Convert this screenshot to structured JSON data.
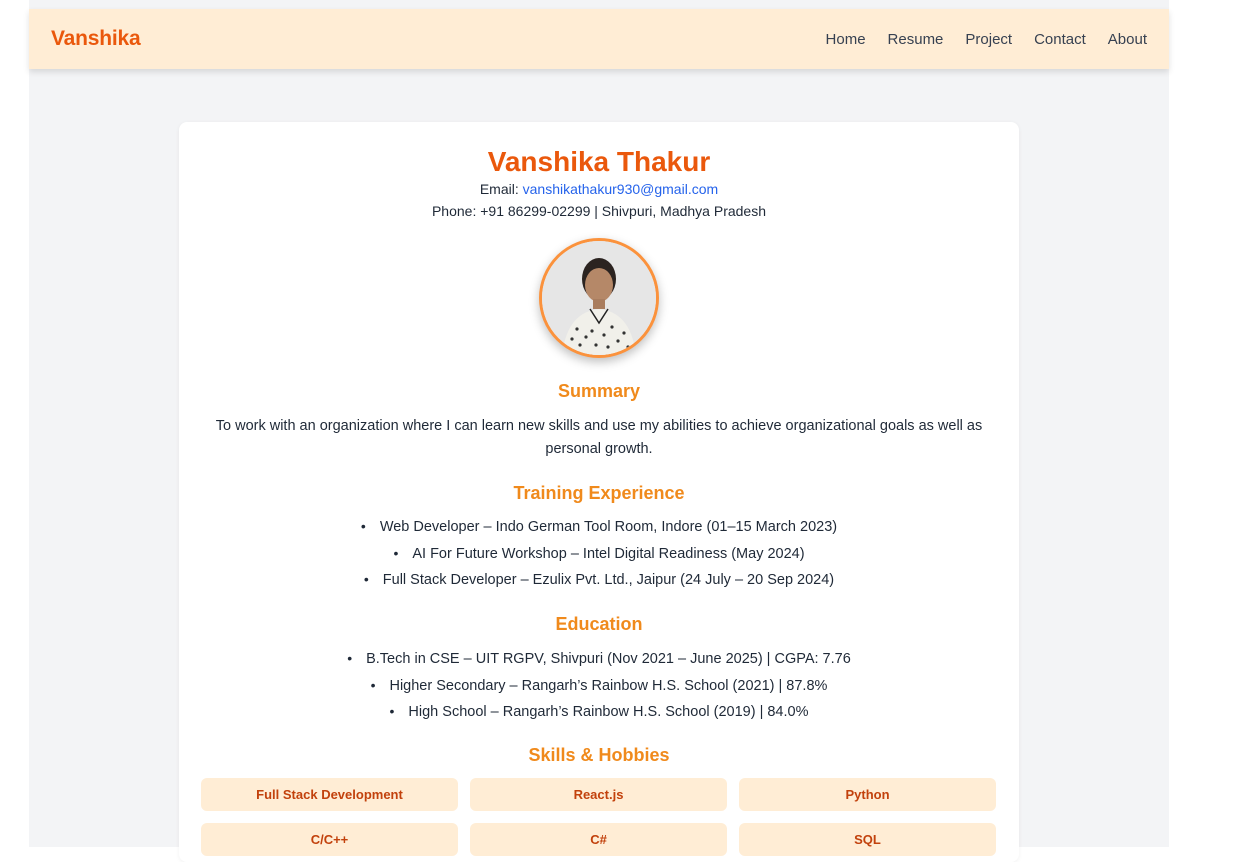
{
  "nav": {
    "brand": "Vanshika",
    "links": [
      "Home",
      "Resume",
      "Project",
      "Contact",
      "About"
    ]
  },
  "profile": {
    "name": "Vanshika Thakur",
    "email_label": "Email: ",
    "email": "vanshikathakur930@gmail.com",
    "phone_line": "Phone: +91 86299-02299 | Shivpuri, Madhya Pradesh"
  },
  "summary": {
    "title": "Summary",
    "text": "To work with an organization where I can learn new skills and use my abilities to achieve organizational goals as well as personal growth."
  },
  "training": {
    "title": "Training Experience",
    "items": [
      "Web Developer – Indo German Tool Room, Indore (01–15 March 2023)",
      "AI For Future Workshop – Intel Digital Readiness (May 2024)",
      "Full Stack Developer – Ezulix Pvt. Ltd., Jaipur (24 July – 20 Sep 2024)"
    ]
  },
  "education": {
    "title": "Education",
    "items": [
      "B.Tech in CSE – UIT RGPV, Shivpuri (Nov 2021 – June 2025) | CGPA: 7.76",
      "Higher Secondary – Rangarh’s Rainbow H.S. School (2021) | 87.8%",
      "High School – Rangarh’s Rainbow H.S. School (2019) | 84.0%"
    ]
  },
  "skills": {
    "title": "Skills & Hobbies",
    "items": [
      "Full Stack Development",
      "React.js",
      "Python",
      "C/C++",
      "C#",
      "SQL"
    ]
  },
  "colors": {
    "accent": "#ea580c",
    "nav_bg": "#ffedd5",
    "link": "#2563eb",
    "section_title": "#f08a1c"
  }
}
